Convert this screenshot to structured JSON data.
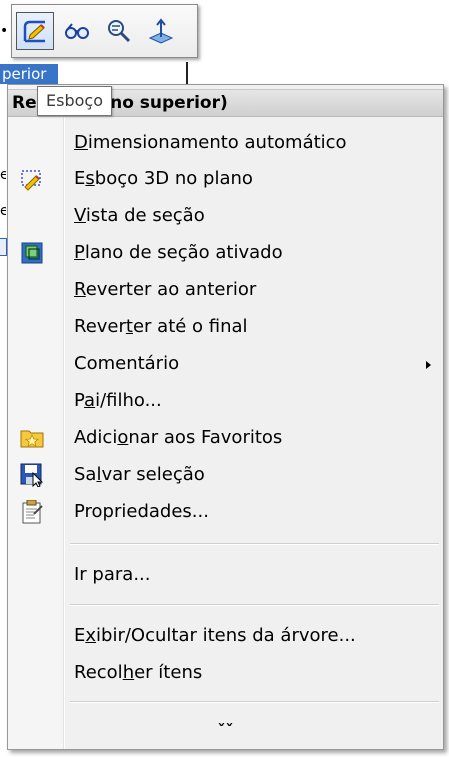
{
  "background": {
    "selected_fragment": "perior"
  },
  "tooltip": "Esboço",
  "toolbar": {
    "buttons": [
      {
        "name": "sketch-icon"
      },
      {
        "name": "glasses-icon"
      },
      {
        "name": "zoom-selection-icon"
      },
      {
        "name": "normal-to-icon"
      }
    ]
  },
  "menu": {
    "header": {
      "prefix": "Re",
      "suffix": "ano superior)"
    },
    "groups": [
      [
        {
          "pre": "",
          "u": "D",
          "post": "imensionamento automático",
          "icon": null
        },
        {
          "pre": "E",
          "u": "s",
          "post": "boço 3D no plano",
          "icon": "sketch3d-icon"
        },
        {
          "pre": "",
          "u": "V",
          "post": "ista de seção",
          "icon": null
        },
        {
          "pre": "",
          "u": "P",
          "post": "lano de seção ativado",
          "icon": "section-plane-icon"
        },
        {
          "pre": "",
          "u": "R",
          "post": "everter ao anterior",
          "icon": null
        },
        {
          "pre": "Rever",
          "u": "t",
          "post": "er até o final",
          "icon": null
        },
        {
          "pre": "Comentário",
          "u": "",
          "post": "",
          "icon": null,
          "submenu": true
        },
        {
          "pre": "P",
          "u": "a",
          "post": "i/filho...",
          "icon": null
        },
        {
          "pre": "Adici",
          "u": "o",
          "post": "nar aos Favoritos",
          "icon": "favorites-icon"
        },
        {
          "pre": "Sa",
          "u": "l",
          "post": "var seleção",
          "icon": "save-selection-icon"
        },
        {
          "pre": "Propriedades...",
          "u": "",
          "post": "",
          "icon": "properties-icon"
        }
      ],
      [
        {
          "pre": "Ir para...",
          "u": "",
          "post": "",
          "icon": null
        }
      ],
      [
        {
          "pre": "E",
          "u": "x",
          "post": "ibir/Ocultar itens da árvore...",
          "icon": null
        },
        {
          "pre": "Recol",
          "u": "h",
          "post": "er ítens",
          "icon": null
        }
      ]
    ],
    "expand_glyph": "ˇˇ"
  }
}
